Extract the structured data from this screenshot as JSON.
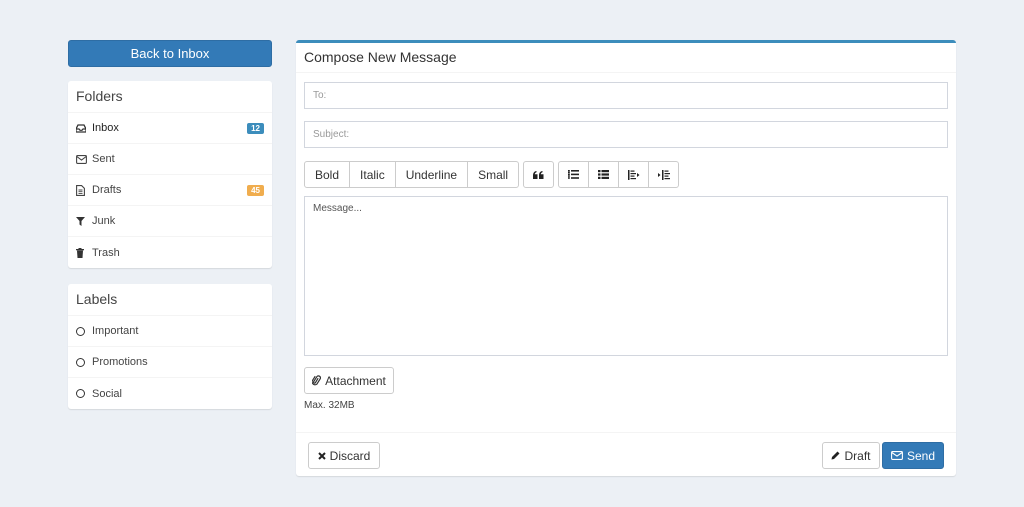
{
  "sidebar": {
    "back_label": "Back to Inbox",
    "folders": {
      "title": "Folders",
      "items": [
        {
          "label": "Inbox",
          "icon": "inbox-icon",
          "badge": "12",
          "badge_color": "#3c8dbc"
        },
        {
          "label": "Sent",
          "icon": "envelope-icon",
          "badge": null,
          "badge_color": null
        },
        {
          "label": "Drafts",
          "icon": "file-icon",
          "badge": "45",
          "badge_color": "#f0ad4e"
        },
        {
          "label": "Junk",
          "icon": "filter-icon",
          "badge": null,
          "badge_color": null
        },
        {
          "label": "Trash",
          "icon": "trash-icon",
          "badge": null,
          "badge_color": null
        }
      ]
    },
    "labels": {
      "title": "Labels",
      "items": [
        {
          "label": "Important",
          "icon": "circle-icon"
        },
        {
          "label": "Promotions",
          "icon": "circle-icon"
        },
        {
          "label": "Social",
          "icon": "circle-icon"
        }
      ]
    }
  },
  "compose": {
    "title": "Compose New Message",
    "to_placeholder": "To:",
    "subject_placeholder": "Subject:",
    "toolbar": {
      "text_buttons": [
        "Bold",
        "Italic",
        "Underline",
        "Small"
      ],
      "quote_icon": "quote-icon",
      "list_icons": [
        "list-ul-icon",
        "list-ol-icon",
        "outdent-icon",
        "indent-icon"
      ]
    },
    "message_placeholder": "Message...",
    "attachment_label": "Attachment",
    "attachment_hint": "Max. 32MB",
    "discard_label": "Discard",
    "draft_label": "Draft",
    "send_label": "Send"
  },
  "colors": {
    "accent": "#337ab7",
    "background": "#ecf0f5",
    "badge_blue": "#3c8dbc",
    "badge_orange": "#f0ad4e"
  }
}
